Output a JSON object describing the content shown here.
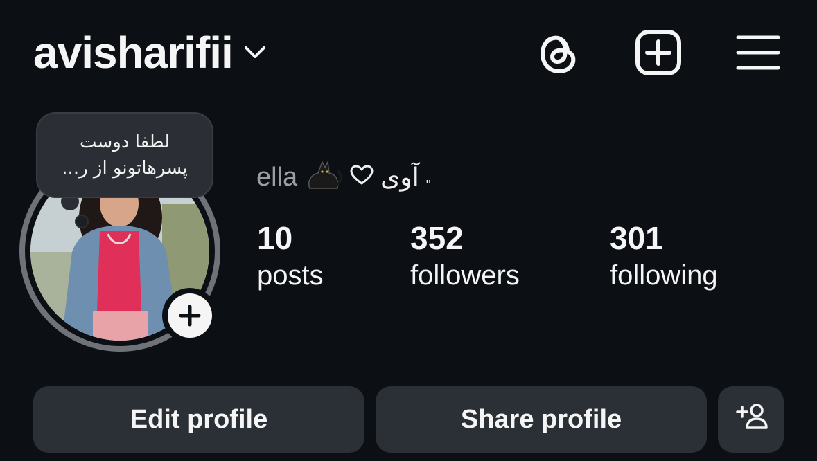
{
  "header": {
    "username": "avisharifii"
  },
  "note": {
    "line1": "لطفا دوست",
    "line2": "پسرهاتونو از ر..."
  },
  "bio": {
    "name": "ella",
    "rtl_text": "آوی",
    "quote_mark": "\""
  },
  "stats": {
    "posts_count": "10",
    "posts_label": "posts",
    "followers_count": "352",
    "followers_label": "followers",
    "following_count": "301",
    "following_label": "following"
  },
  "buttons": {
    "edit_label": "Edit profile",
    "share_label": "Share profile"
  },
  "icons": {
    "threads": "threads-icon",
    "create": "create-post-icon",
    "menu": "menu-icon",
    "add_user": "add-user-icon",
    "chevron": "chevron-down-icon"
  },
  "colors": {
    "background": "#0c1014",
    "button_bg": "#2b2f36",
    "text_primary": "#f5f5f5",
    "text_muted": "#9a9ea3"
  }
}
